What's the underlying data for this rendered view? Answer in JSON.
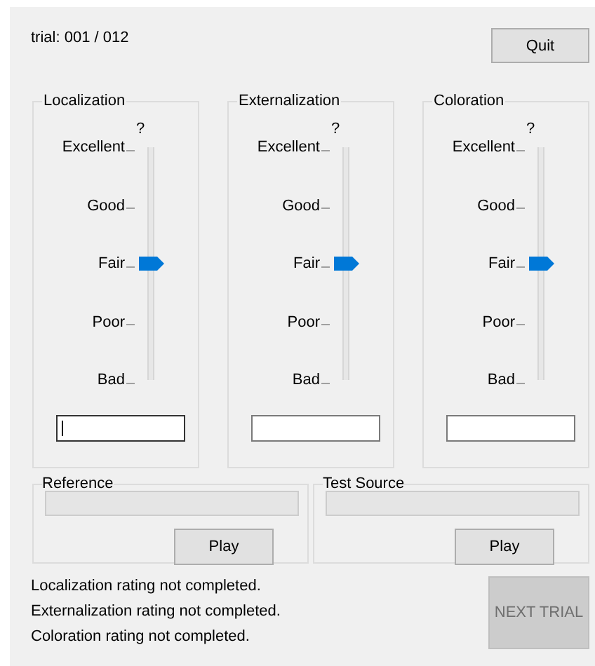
{
  "trial_label": "trial: 001 / 012",
  "quit_button": {
    "label": "Quit"
  },
  "rating_groups": [
    {
      "title": "Localization",
      "marker": "?",
      "scale": [
        "Excellent",
        "Good",
        "Fair",
        "Poor",
        "Bad"
      ],
      "level": 0.5,
      "input": {
        "focused": true
      }
    },
    {
      "title": "Externalization",
      "marker": "?",
      "scale": [
        "Excellent",
        "Good",
        "Fair",
        "Poor",
        "Bad"
      ],
      "level": 0.5,
      "input": {
        "focused": false
      }
    },
    {
      "title": "Coloration",
      "marker": "?",
      "scale": [
        "Excellent",
        "Good",
        "Fair",
        "Poor",
        "Bad"
      ],
      "level": 0.5,
      "input": {
        "focused": false
      }
    }
  ],
  "sources": [
    {
      "title": "Reference",
      "play_button": "Play"
    },
    {
      "title": "Test Source",
      "play_button": "Play"
    }
  ],
  "status_messages": [
    "Localization rating not completed.",
    "Externalization rating not completed.",
    "Coloration rating not completed."
  ],
  "next_button": {
    "label": "NEXT TRIAL",
    "disabled": true
  }
}
